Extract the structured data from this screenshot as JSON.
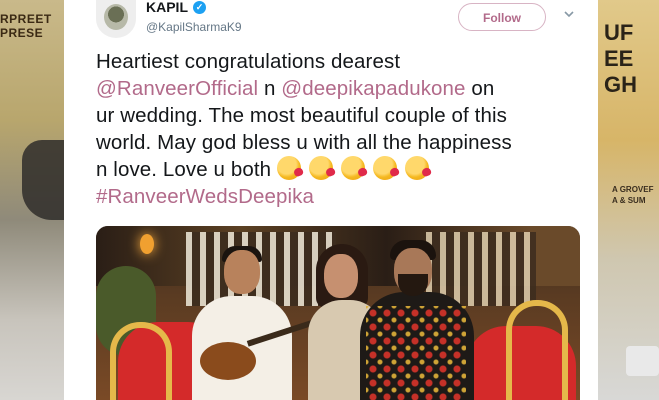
{
  "backdrop": {
    "left_text": "RPREET\nPRESE",
    "right_text": "UF\nEE\nGH",
    "right_sub": "A GROVEF\nA & SUM"
  },
  "tweet": {
    "display_name": "KAPIL",
    "handle": "@KapilSharmaK9",
    "follow_label": "Follow",
    "lines": {
      "l1": "Heartiest congratulations dearest",
      "l2_mention1": "@RanveerOfficial",
      "l2_mid": " n ",
      "l2_mention2": "@deepikapadukone",
      "l2_end": " on",
      "l3": "ur wedding. The most beautiful couple of this",
      "l4": "world. May god bless u with all the happiness",
      "l5": "n love. Love u both ",
      "l6_hashtag": "#RanveerWedsDeepika"
    },
    "emoji_name": "face-blowing-kiss-icon",
    "emoji_count": 5
  },
  "colors": {
    "link": "#b26a8a",
    "verified": "#1da1f2",
    "text": "#14171a",
    "muted": "#657786"
  }
}
